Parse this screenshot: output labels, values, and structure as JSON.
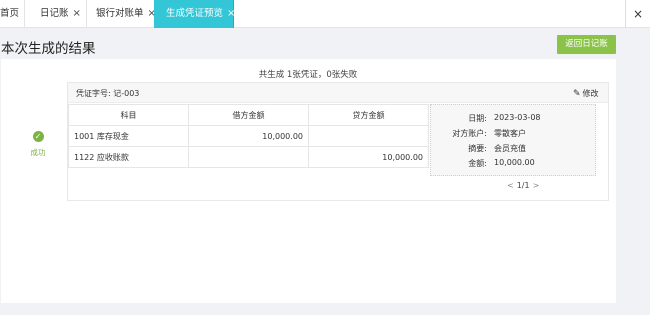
{
  "tabs": [
    {
      "label": "首页"
    },
    {
      "label": "日记账",
      "close": "×"
    },
    {
      "label": "银行对账单",
      "close": "×"
    },
    {
      "label": "生成凭证预览",
      "close": "×"
    }
  ],
  "window_close": "×",
  "page_title": "本次生成的结果",
  "back_button": "返回日记账",
  "summary": "共生成 1张凭证，0张失败",
  "status": {
    "icon": "check-icon",
    "text": "成功"
  },
  "voucher": {
    "number_label": "凭证字号: 记-003",
    "edit_label": "修改",
    "columns": [
      "科目",
      "借方金额",
      "贷方金额"
    ],
    "rows": [
      {
        "account": "1001 库存现金",
        "debit": "10,000.00",
        "credit": ""
      },
      {
        "account": "1122 应收账款",
        "debit": "",
        "credit": "10,000.00"
      }
    ],
    "info": {
      "date_label": "日期:",
      "date": "2023-03-08",
      "counterparty_label": "对方账户:",
      "counterparty": "零散客户",
      "summary_label": "摘要:",
      "summary": "会员充值",
      "amount_label": "金额:",
      "amount": "10,000.00"
    },
    "pager": {
      "prev": "<",
      "current": "1/1",
      "next": ">"
    }
  },
  "colors": {
    "accent": "#33c6d6",
    "success": "#7cb342",
    "button": "#8bc34a"
  }
}
